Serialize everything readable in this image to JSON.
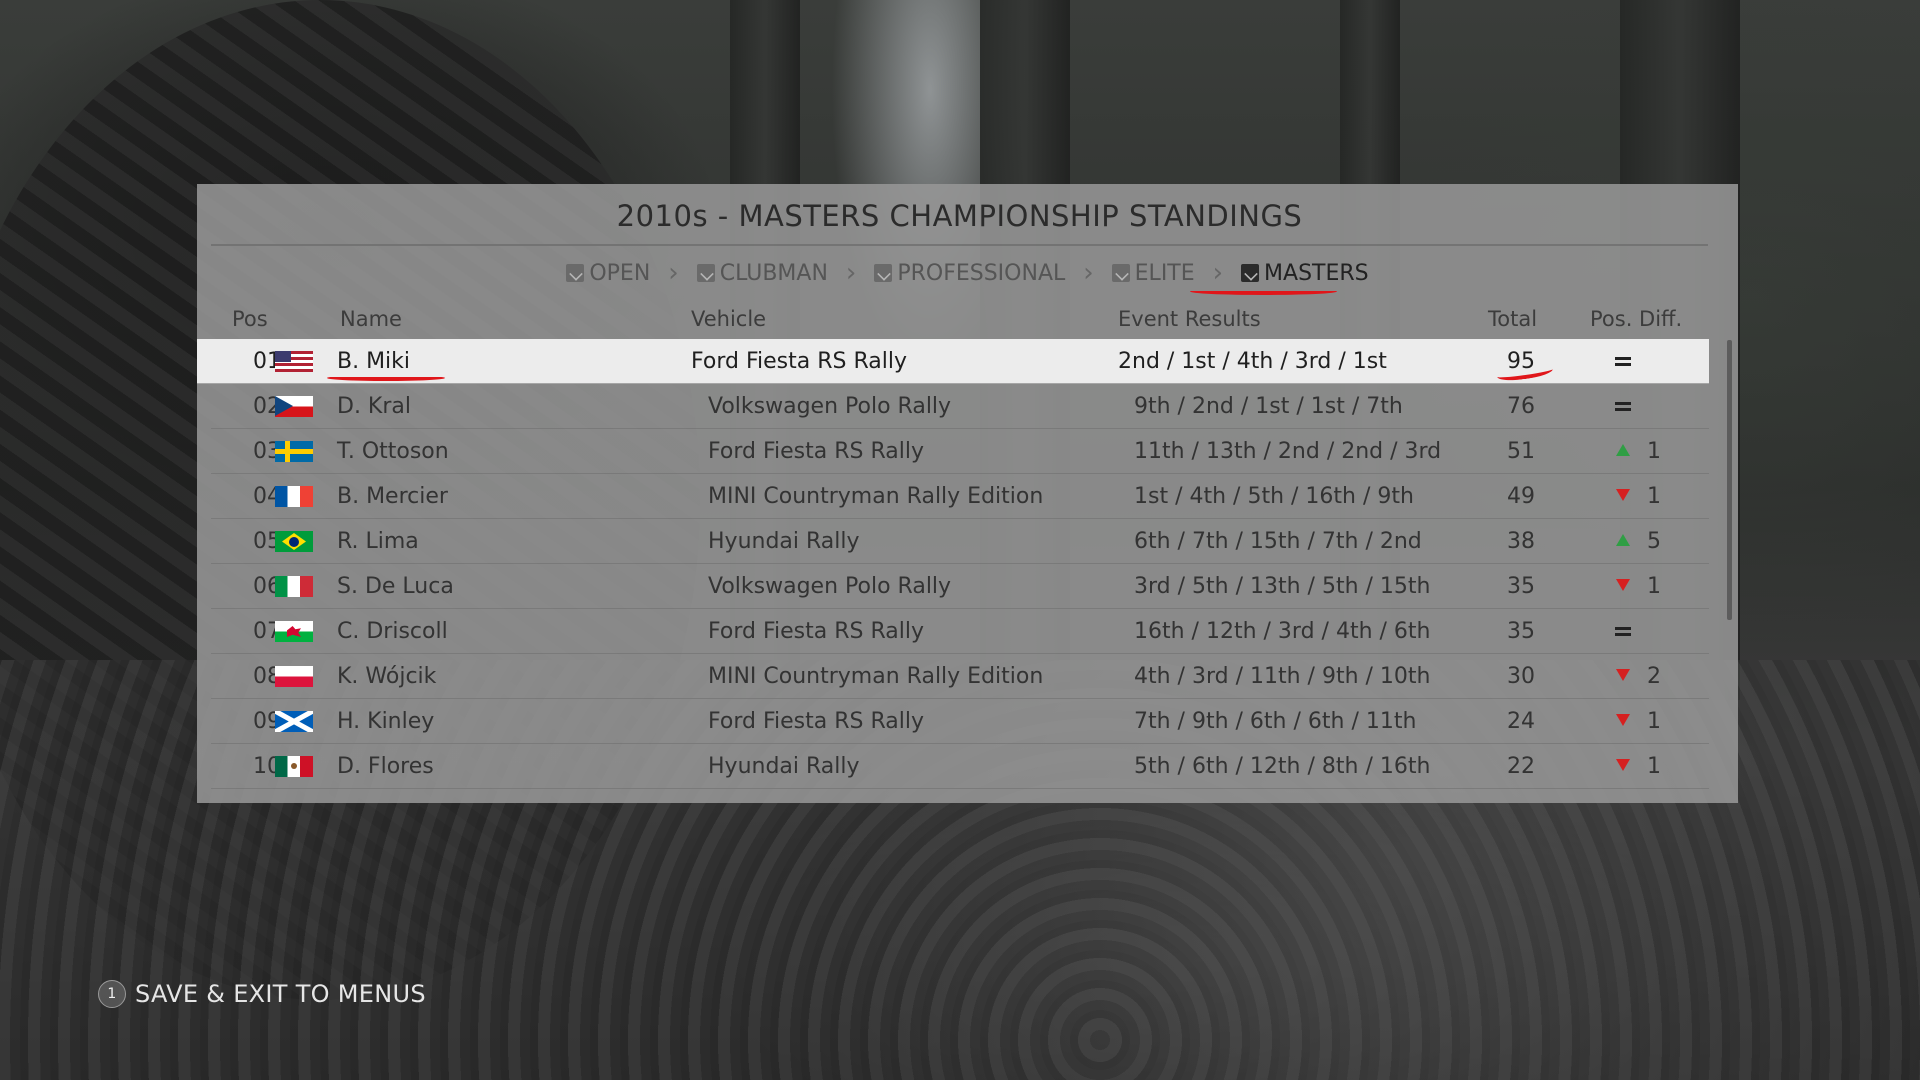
{
  "title": "2010s - MASTERS CHAMPIONSHIP STANDINGS",
  "tiers": [
    {
      "label": "OPEN",
      "active": false
    },
    {
      "label": "CLUBMAN",
      "active": false
    },
    {
      "label": "PROFESSIONAL",
      "active": false
    },
    {
      "label": "ELITE",
      "active": false
    },
    {
      "label": "MASTERS",
      "active": true
    }
  ],
  "columns": {
    "pos": "Pos",
    "name": "Name",
    "vehicle": "Vehicle",
    "results": "Event Results",
    "total": "Total",
    "diff": "Pos. Diff."
  },
  "standings": [
    {
      "pos": "01",
      "flag": "us-flag",
      "name": "B. Miki",
      "vehicle": "Ford Fiesta RS Rally",
      "results": "2nd / 1st / 4th / 3rd / 1st",
      "total": "95",
      "trend": "same",
      "change": ""
    },
    {
      "pos": "02",
      "flag": "czech-flag",
      "name": "D. Kral",
      "vehicle": "Volkswagen Polo Rally",
      "results": "9th / 2nd / 1st / 1st / 7th",
      "total": "76",
      "trend": "same",
      "change": ""
    },
    {
      "pos": "03",
      "flag": "sweden-flag",
      "name": "T. Ottoson",
      "vehicle": "Ford Fiesta RS Rally",
      "results": "11th / 13th / 2nd / 2nd / 3rd",
      "total": "51",
      "trend": "up",
      "change": "1"
    },
    {
      "pos": "04",
      "flag": "france-flag",
      "name": "B. Mercier",
      "vehicle": "MINI Countryman Rally Edition",
      "results": "1st / 4th / 5th / 16th / 9th",
      "total": "49",
      "trend": "down",
      "change": "1"
    },
    {
      "pos": "05",
      "flag": "brazil-flag",
      "name": "R. Lima",
      "vehicle": "Hyundai Rally",
      "results": "6th / 7th / 15th / 7th / 2nd",
      "total": "38",
      "trend": "up",
      "change": "5"
    },
    {
      "pos": "06",
      "flag": "italy-flag",
      "name": "S. De Luca",
      "vehicle": "Volkswagen Polo Rally",
      "results": "3rd / 5th / 13th / 5th / 15th",
      "total": "35",
      "trend": "down",
      "change": "1"
    },
    {
      "pos": "07",
      "flag": "wales-flag",
      "name": "C. Driscoll",
      "vehicle": "Ford Fiesta RS Rally",
      "results": "16th / 12th / 3rd / 4th / 6th",
      "total": "35",
      "trend": "same",
      "change": ""
    },
    {
      "pos": "08",
      "flag": "poland-flag",
      "name": "K. Wójcik",
      "vehicle": "MINI Countryman Rally Edition",
      "results": "4th / 3rd / 11th / 9th / 10th",
      "total": "30",
      "trend": "down",
      "change": "2"
    },
    {
      "pos": "09",
      "flag": "scotland-flag",
      "name": "H. Kinley",
      "vehicle": "Ford Fiesta RS Rally",
      "results": "7th / 9th / 6th / 6th / 11th",
      "total": "24",
      "trend": "down",
      "change": "1"
    },
    {
      "pos": "10",
      "flag": "mexico-flag",
      "name": "D. Flores",
      "vehicle": "Hyundai Rally",
      "results": "5th / 6th / 12th / 8th / 16th",
      "total": "22",
      "trend": "down",
      "change": "1"
    }
  ],
  "footer": {
    "button": "1",
    "label": "SAVE & EXIT TO MENUS"
  },
  "colors": {
    "up": "#2f9e44",
    "down": "#d62020",
    "annotation": "#e0161a",
    "highlight_row": "#ececec"
  }
}
